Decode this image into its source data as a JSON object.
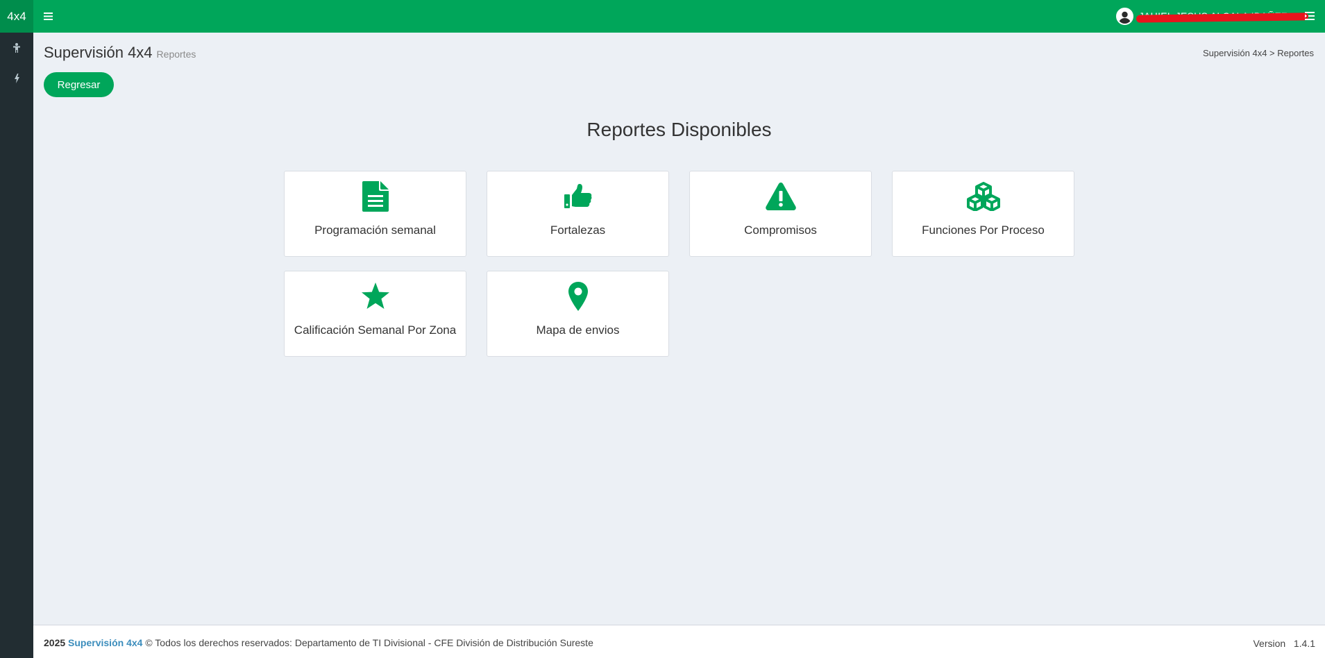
{
  "header": {
    "logo_text": "4x4",
    "user_name": "JAHIEL JESUS ALCALA IBAÑEZ",
    "accent_color": "#00a65a"
  },
  "sidebar": {
    "items": [
      {
        "icon": "person-icon"
      },
      {
        "icon": "bolt-icon"
      }
    ]
  },
  "page": {
    "title": "Supervisión 4x4",
    "subtitle": "Reportes",
    "breadcrumb": "Supervisión 4x4 > Reportes",
    "back_button": "Regresar",
    "section_title": "Reportes Disponibles"
  },
  "reports": [
    {
      "label": "Programación semanal",
      "icon": "document-icon"
    },
    {
      "label": "Fortalezas",
      "icon": "thumbs-up-icon"
    },
    {
      "label": "Compromisos",
      "icon": "warning-icon"
    },
    {
      "label": "Funciones Por Proceso",
      "icon": "cubes-icon"
    },
    {
      "label": "Calificación Semanal Por Zona",
      "icon": "star-icon"
    },
    {
      "label": "Mapa de envios",
      "icon": "map-marker-icon"
    }
  ],
  "footer": {
    "year": "2025",
    "brand": "Supervisión 4x4",
    "rights": "© Todos los derechos reservados: Departamento de TI Divisional - CFE División de Distribución Sureste",
    "version_label": "Version",
    "version": "1.4.1"
  }
}
